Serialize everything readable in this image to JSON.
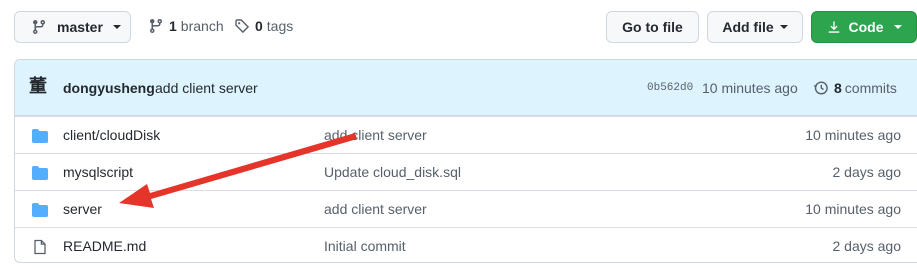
{
  "toolbar": {
    "branch_label": "master",
    "branch_count": "1",
    "branch_word": "branch",
    "tag_count": "0",
    "tag_word": "tags",
    "goto_label": "Go to file",
    "addfile_label": "Add file",
    "code_label": "Code"
  },
  "commit": {
    "avatar_glyph": "董",
    "author": "dongyusheng",
    "message": "add client server",
    "sha": "0b562d0",
    "time": "10 minutes ago",
    "count": "8",
    "count_word": "commits"
  },
  "files": [
    {
      "name": "client/cloudDisk",
      "message": "add client server",
      "time": "10 minutes ago",
      "icon": "folder-icon"
    },
    {
      "name": "mysqlscript",
      "message": "Update cloud_disk.sql",
      "time": "2 days ago",
      "icon": "folder-icon"
    },
    {
      "name": "server",
      "message": "add client server",
      "time": "10 minutes ago",
      "icon": "folder-icon"
    },
    {
      "name": "README.md",
      "message": "Initial commit",
      "time": "2 days ago",
      "icon": "file-icon"
    }
  ],
  "colors": {
    "accent_green": "#2da44e",
    "folder_blue": "#54aeff",
    "commit_bar_bg": "#ddf4ff",
    "annotation_red": "#e5342a"
  }
}
